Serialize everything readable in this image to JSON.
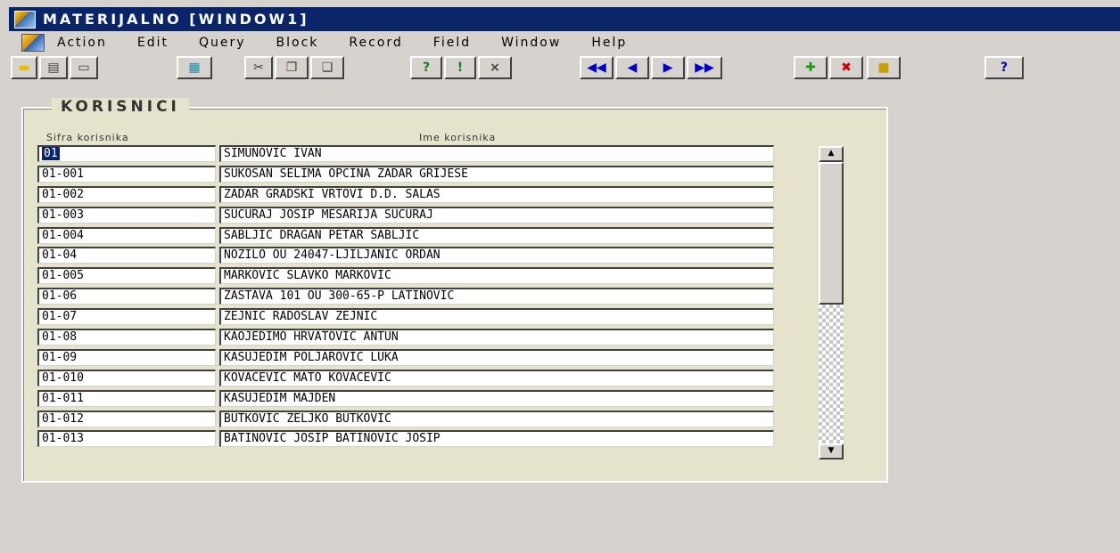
{
  "window": {
    "title": "MATERIJALNO [WINDOW1]"
  },
  "menu": {
    "items": [
      "Action",
      "Edit",
      "Query",
      "Block",
      "Record",
      "Field",
      "Window",
      "Help"
    ]
  },
  "toolbar": {
    "buttons": [
      {
        "icon": "save-icon",
        "glyph": "▬",
        "color": "#e8c000"
      },
      {
        "icon": "print-icon",
        "glyph": "▤",
        "color": "#404040"
      },
      {
        "icon": "exit-icon",
        "glyph": "▭",
        "color": "#404040"
      },
      {
        "icon": "list-of-values-icon",
        "glyph": "▦",
        "color": "#1a8aa8"
      },
      {
        "icon": "cut-icon",
        "glyph": "✂",
        "color": "#404040"
      },
      {
        "icon": "copy-icon",
        "glyph": "❐",
        "color": "#404040"
      },
      {
        "icon": "paste-icon",
        "glyph": "❏",
        "color": "#404040"
      },
      {
        "icon": "enter-query-icon",
        "glyph": "?",
        "color": "#1a7a1a"
      },
      {
        "icon": "execute-query-icon",
        "glyph": "!",
        "color": "#1a7a1a"
      },
      {
        "icon": "cancel-query-icon",
        "glyph": "×",
        "color": "#404040"
      },
      {
        "icon": "first-record-icon",
        "glyph": "◀◀",
        "color": "#0000cc"
      },
      {
        "icon": "previous-record-icon",
        "glyph": "◀",
        "color": "#0000cc"
      },
      {
        "icon": "next-record-icon",
        "glyph": "▶",
        "color": "#0000cc"
      },
      {
        "icon": "last-record-icon",
        "glyph": "▶▶",
        "color": "#0000cc"
      },
      {
        "icon": "insert-record-icon",
        "glyph": "✚",
        "color": "#1a9a1a"
      },
      {
        "icon": "delete-record-icon",
        "glyph": "✖",
        "color": "#cc0000"
      },
      {
        "icon": "lock-record-icon",
        "glyph": "■",
        "color": "#c8a000"
      },
      {
        "icon": "help-icon",
        "glyph": "?",
        "color": "#0000aa"
      }
    ]
  },
  "frame": {
    "title": "KORISNICI",
    "columns": {
      "code": "Sifra korisnika",
      "name": "Ime korisnika"
    },
    "rows": [
      {
        "code": "01",
        "name": "SIMUNOVIC IVAN"
      },
      {
        "code": "01-001",
        "name": "SUKOSAN SELIMA OPCINA ZADAR GRIJESE"
      },
      {
        "code": "01-002",
        "name": "ZADAR GRADSKI VRTOVI D.D. SALAS"
      },
      {
        "code": "01-003",
        "name": "SUCURAJ JOSIP MESARIJA SUCURAJ"
      },
      {
        "code": "01-004",
        "name": "SABLJIC DRAGAN PETAR SABLJIC"
      },
      {
        "code": "01-04",
        "name": "NOZILO OU 24047-LJILJANIĆ ORDAN"
      },
      {
        "code": "01-005",
        "name": "MARKOVIC SLAVKO MARKOVIC"
      },
      {
        "code": "01-06",
        "name": "ZASTAVA 101 OU 300-65-P LATINOVIĆ"
      },
      {
        "code": "01-07",
        "name": "ZEJNIC RADOSLAV ZEJNIC"
      },
      {
        "code": "01-08",
        "name": "KAOJEDIMO HRVATOVIĆ ANTUN"
      },
      {
        "code": "01-09",
        "name": "KASUJEDIM POLJAROVIĆ LUKA"
      },
      {
        "code": "01-010",
        "name": "KOVACEVIC MATO KOVACEVIC"
      },
      {
        "code": "01-011",
        "name": "KASUJEDIM MAJDEN"
      },
      {
        "code": "01-012",
        "name": "BUTKOVIC ZELJKO BUTKOVIC"
      },
      {
        "code": "01-013",
        "name": "BATINOVIC JOSIP BATINOVIC JOSIP"
      }
    ]
  }
}
